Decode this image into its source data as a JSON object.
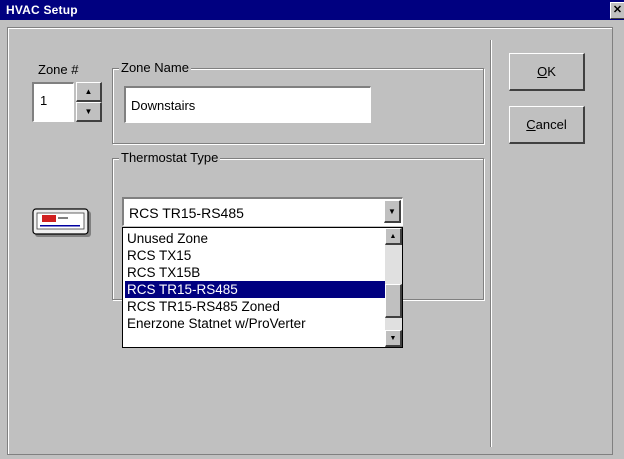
{
  "window": {
    "title": "HVAC Setup",
    "close_glyph": "✕"
  },
  "zone_number": {
    "label": "Zone #",
    "value": "1"
  },
  "zone_name": {
    "legend": "Zone Name",
    "value": "Downstairs"
  },
  "thermostat_type": {
    "legend": "Thermostat Type",
    "selected_value": "RCS TR15-RS485",
    "options": [
      "Unused Zone",
      "RCS TX15",
      "RCS TX15B",
      "RCS TR15-RS485",
      "RCS TR15-RS485 Zoned",
      "Enerzone Statnet w/ProVerter"
    ],
    "highlighted_index": 3,
    "icon": "thermostat-icon"
  },
  "buttons": {
    "ok": {
      "mnemonic": "O",
      "rest": "K"
    },
    "cancel": {
      "mnemonic": "C",
      "rest": "ancel"
    }
  },
  "colors": {
    "titlebar": "#000080",
    "face": "#c0c0c0",
    "selection": "#000080"
  }
}
